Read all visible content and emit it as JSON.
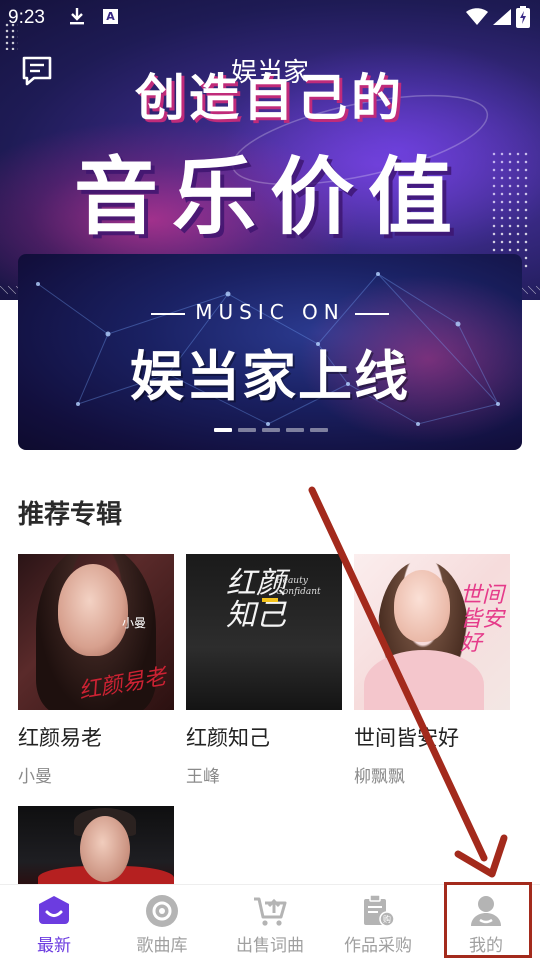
{
  "status_bar": {
    "time": "9:23",
    "icons": [
      "download-icon",
      "a-icon",
      "wifi-icon",
      "signal-icon",
      "battery-charging-icon"
    ]
  },
  "header": {
    "title": "娱当家",
    "message_icon": "message-icon"
  },
  "hero": {
    "line1": "创造自己的",
    "line2": "音乐价值"
  },
  "banner": {
    "subtitle": "MUSIC ON",
    "title": "娱当家上线",
    "indicator_count": 5,
    "active_index": 0
  },
  "recommended": {
    "title": "推荐专辑",
    "albums": [
      {
        "name": "红颜易老",
        "artist": "小曼",
        "cover_text": "红颜易老",
        "cover_small": "小曼"
      },
      {
        "name": "红颜知己",
        "artist": "王峰",
        "cover_text": "红颜知己",
        "cover_en": "Beauty Confidant"
      },
      {
        "name": "世间皆安好",
        "artist": "柳飘飘",
        "cover_text": "世间皆安好"
      },
      {
        "name": "",
        "artist": ""
      }
    ]
  },
  "tabbar": {
    "tabs": [
      {
        "label": "最新",
        "icon": "home-smile-icon",
        "active": true
      },
      {
        "label": "歌曲库",
        "icon": "disc-icon",
        "active": false
      },
      {
        "label": "出售词曲",
        "icon": "cart-upload-icon",
        "active": false
      },
      {
        "label": "作品采购",
        "icon": "document-purchase-icon",
        "active": false
      },
      {
        "label": "我的",
        "icon": "user-icon",
        "active": false
      }
    ]
  },
  "colors": {
    "accent": "#6c3ce0",
    "annotation": "#a32a1c",
    "inactive": "#a0a0a0"
  }
}
